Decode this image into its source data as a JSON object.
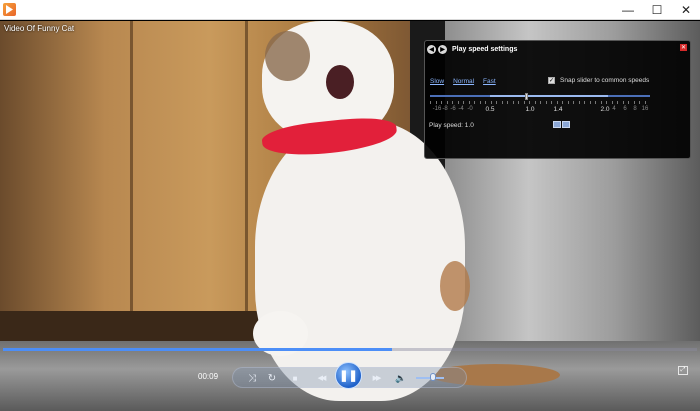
{
  "window": {
    "app_icon": "media-player-icon",
    "buttons": {
      "minimize": "—",
      "maximize": "☐",
      "close": "✕"
    }
  },
  "video": {
    "title": "Video Of Funny Cat"
  },
  "speed_panel": {
    "title": "Play speed settings",
    "back_glyph": "◀",
    "forward_glyph": "▶",
    "close_glyph": "✕",
    "links": [
      "Slow",
      "Normal",
      "Fast"
    ],
    "snap_checked": true,
    "snap_label": "Snap slider to common speeds",
    "snap_check_glyph": "✓",
    "tick_labels": [
      {
        "text": "-16",
        "major": false
      },
      {
        "text": "-8",
        "major": false
      },
      {
        "text": "-6",
        "major": false
      },
      {
        "text": "-4",
        "major": false
      },
      {
        "text": "-0",
        "major": false
      },
      {
        "text": "0.5",
        "major": true
      },
      {
        "text": "1.0",
        "major": true
      },
      {
        "text": "1.4",
        "major": true
      },
      {
        "text": "2.0",
        "major": true
      },
      {
        "text": "4",
        "major": false
      },
      {
        "text": "6",
        "major": false
      },
      {
        "text": "8",
        "major": false
      },
      {
        "text": "16",
        "major": false
      }
    ],
    "play_speed_label": "Play speed:",
    "play_speed_value": "1.0",
    "slider_value": 1.0
  },
  "controls": {
    "time": "00:09",
    "seek_progress_fraction": 0.56,
    "volume_fraction": 0.6,
    "glyphs": {
      "shuffle": "⤨",
      "repeat": "↻",
      "stop": "■",
      "previous": "◀◀",
      "pause": "❚❚",
      "next": "▶▶",
      "volume": "🔈",
      "fullscreen": "⤢"
    }
  },
  "colors": {
    "accent": "#4c8ef7",
    "panel_bg": "#000000",
    "link": "#8cb7ff",
    "close_red": "#d52a2a"
  }
}
